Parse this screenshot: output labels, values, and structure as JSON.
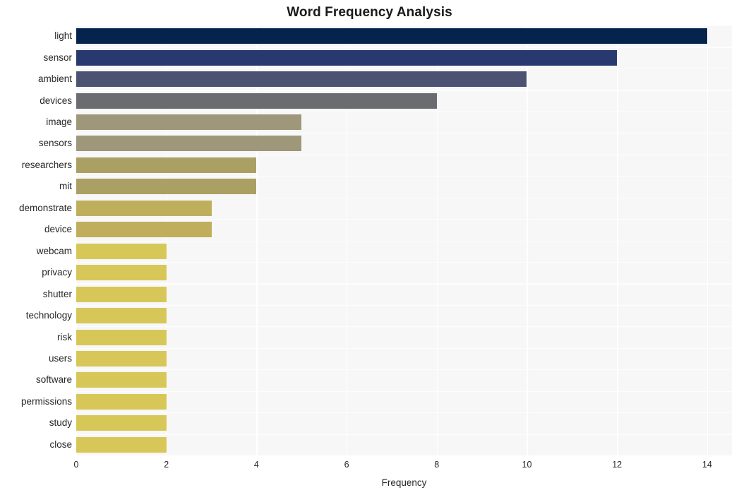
{
  "chart_data": {
    "type": "bar",
    "orientation": "horizontal",
    "title": "Word Frequency Analysis",
    "xlabel": "Frequency",
    "ylabel": "",
    "categories": [
      "light",
      "sensor",
      "ambient",
      "devices",
      "image",
      "sensors",
      "researchers",
      "mit",
      "demonstrate",
      "device",
      "webcam",
      "privacy",
      "shutter",
      "technology",
      "risk",
      "users",
      "software",
      "permissions",
      "study",
      "close"
    ],
    "values": [
      14,
      12,
      10,
      8,
      5,
      5,
      4,
      4,
      3,
      3,
      2,
      2,
      2,
      2,
      2,
      2,
      2,
      2,
      2,
      2
    ],
    "bar_colors": [
      "#04244d",
      "#27396e",
      "#4c5372",
      "#6b6c70",
      "#9e9779",
      "#9e9779",
      "#aaa063",
      "#aaa063",
      "#bfaf5c",
      "#bfaf5c",
      "#d7c758",
      "#d7c758",
      "#d7c758",
      "#d7c758",
      "#d7c758",
      "#d7c758",
      "#d7c758",
      "#d7c758",
      "#d7c758",
      "#d7c758"
    ],
    "xlim": [
      0,
      14.55
    ],
    "xticks": [
      0,
      2,
      4,
      6,
      8,
      10,
      12,
      14
    ],
    "xtick_labels": [
      "0",
      "2",
      "4",
      "6",
      "8",
      "10",
      "12",
      "14"
    ],
    "grid": true,
    "grid_color": "#ffffff",
    "plot_background": "#f7f7f7",
    "figure_background": "#ffffff",
    "legend": null,
    "text_color": "#262626"
  }
}
